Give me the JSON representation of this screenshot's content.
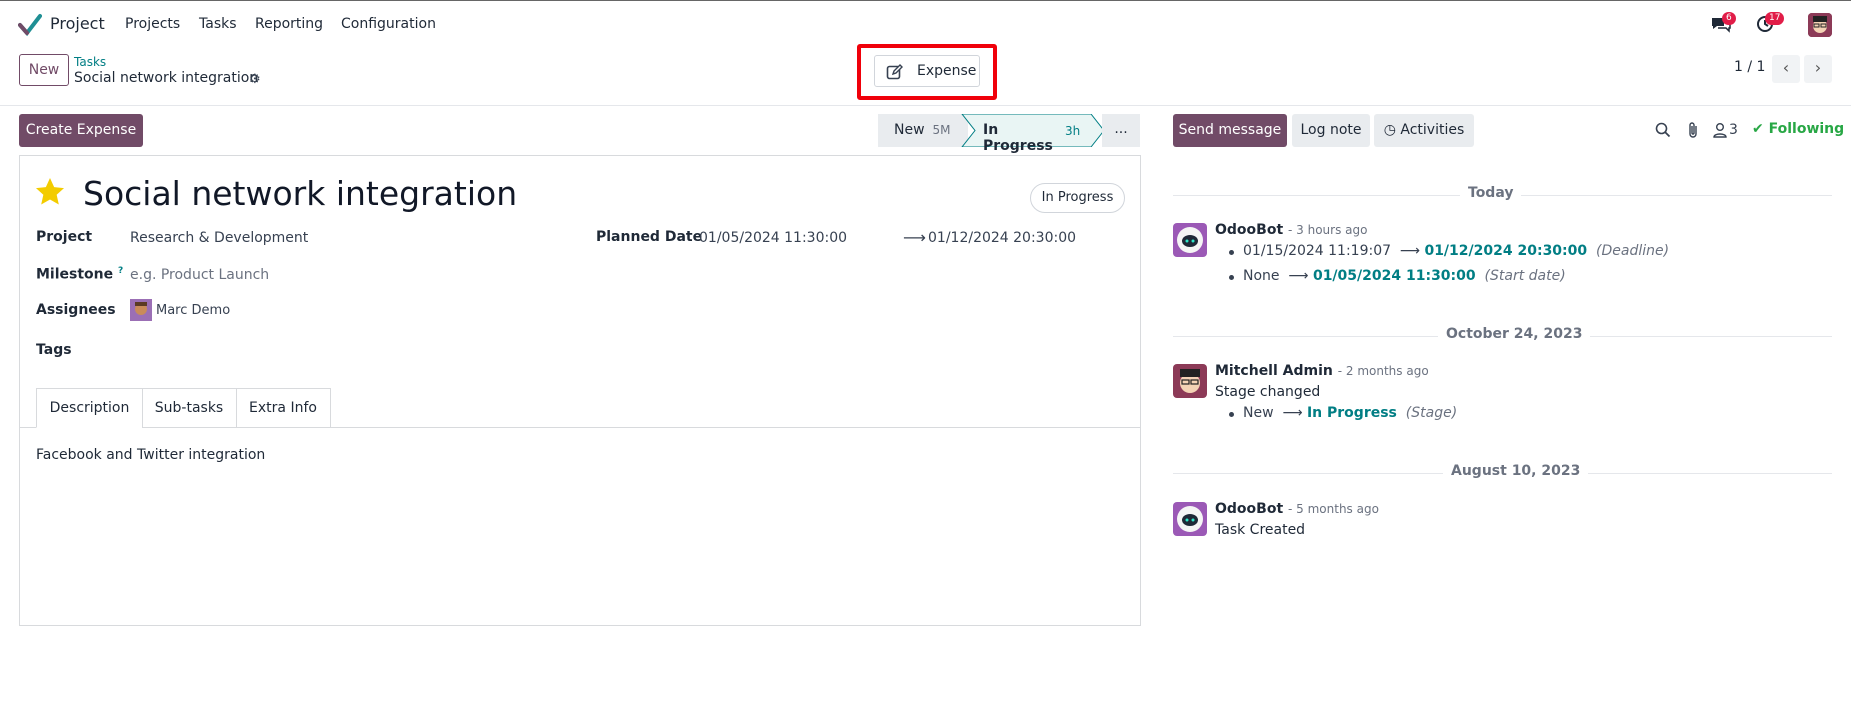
{
  "navbar": {
    "app_name": "Project",
    "menu": [
      "Projects",
      "Tasks",
      "Reporting",
      "Configuration"
    ],
    "messages_count": "6",
    "activities_count": "17"
  },
  "control_panel": {
    "new_label": "New",
    "breadcrumb_parent": "Tasks",
    "breadcrumb_current": "Social network integration",
    "expense_label": "Expense",
    "pager": "1 / 1"
  },
  "actions": {
    "create_expense": "Create Expense"
  },
  "stages": {
    "new_label": "New",
    "new_time": "5M",
    "inprogress_label": "In Progress",
    "inprogress_time": "3h",
    "more": "..."
  },
  "task": {
    "title": "Social network integration",
    "state": "In Progress",
    "project_label": "Project",
    "project_value": "Research & Development",
    "milestone_label": "Milestone",
    "milestone_help": "?",
    "milestone_placeholder": "e.g. Product Launch",
    "assignees_label": "Assignees",
    "assignee": "Marc Demo",
    "tags_label": "Tags",
    "planned_label": "Planned Date",
    "planned_start": "01/05/2024 11:30:00",
    "planned_end": "01/12/2024 20:30:00",
    "tabs": [
      "Description",
      "Sub-tasks",
      "Extra Info"
    ],
    "description": "Facebook and Twitter integration"
  },
  "chatter": {
    "send_message": "Send message",
    "log_note": "Log note",
    "activities": "Activities",
    "followers_count": "3",
    "following": "Following",
    "groups": [
      {
        "date": "Today",
        "author": "OdooBot",
        "ago": "- 3 hours ago",
        "tracking": [
          {
            "old": "01/15/2024 11:19:07",
            "new": "01/12/2024 20:30:00",
            "field": "(Deadline)"
          },
          {
            "old": "None",
            "new": "01/05/2024 11:30:00",
            "field": "(Start date)"
          }
        ]
      },
      {
        "date": "October 24, 2023",
        "author": "Mitchell Admin",
        "ago": "- 2 months ago",
        "text": "Stage changed",
        "tracking": [
          {
            "old": "New",
            "new": "In Progress",
            "field": "(Stage)"
          }
        ]
      },
      {
        "date": "August 10, 2023",
        "author": "OdooBot",
        "ago": "- 5 months ago",
        "text": "Task Created"
      }
    ]
  },
  "colors": {
    "primary": "#714B67",
    "link": "#017e84",
    "highlight": "#f0000a",
    "following": "#28a745"
  }
}
